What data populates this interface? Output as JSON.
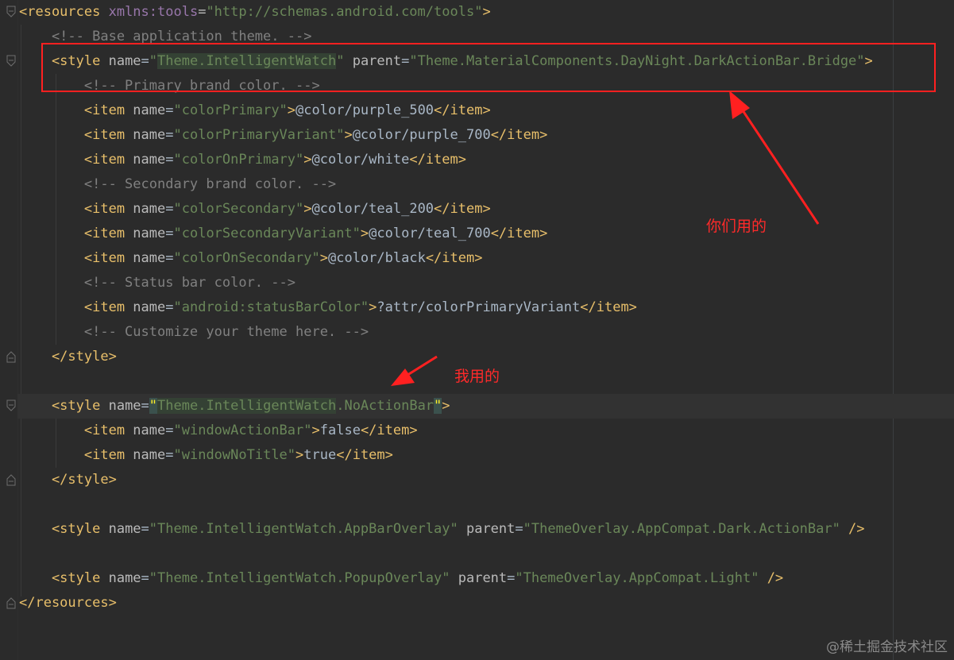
{
  "editor": {
    "lines": [
      {
        "parts": [
          [
            "tag",
            "<resources "
          ],
          [
            "ns",
            "xmlns:tools"
          ],
          [
            "attr",
            "="
          ],
          [
            "val",
            "\"http://schemas.android.com/tools\""
          ],
          [
            "tag",
            ">"
          ]
        ]
      },
      {
        "parts": [
          [
            "com",
            "    <!-- Base application theme. -->"
          ]
        ]
      },
      {
        "parts": [
          [
            "tag",
            "    <style "
          ],
          [
            "attr",
            "name"
          ],
          [
            "txt",
            "="
          ],
          [
            "val",
            "\""
          ],
          [
            "valhl",
            "Theme.IntelligentWatch"
          ],
          [
            "val",
            "\""
          ],
          [
            "attr",
            " parent"
          ],
          [
            "txt",
            "="
          ],
          [
            "val",
            "\"Theme.MaterialComponents.DayNight.DarkActionBar.Bridge\""
          ],
          [
            "tag",
            ">"
          ]
        ]
      },
      {
        "parts": [
          [
            "com",
            "        <!-- Primary brand color. -->"
          ]
        ]
      },
      {
        "parts": [
          [
            "tag",
            "        <item "
          ],
          [
            "attr",
            "name"
          ],
          [
            "txt",
            "="
          ],
          [
            "val",
            "\"colorPrimary\""
          ],
          [
            "tag",
            ">"
          ],
          [
            "txt",
            "@color/purple_500"
          ],
          [
            "tag",
            "</item>"
          ]
        ]
      },
      {
        "parts": [
          [
            "tag",
            "        <item "
          ],
          [
            "attr",
            "name"
          ],
          [
            "txt",
            "="
          ],
          [
            "val",
            "\"colorPrimaryVariant\""
          ],
          [
            "tag",
            ">"
          ],
          [
            "txt",
            "@color/purple_700"
          ],
          [
            "tag",
            "</item>"
          ]
        ]
      },
      {
        "parts": [
          [
            "tag",
            "        <item "
          ],
          [
            "attr",
            "name"
          ],
          [
            "txt",
            "="
          ],
          [
            "val",
            "\"colorOnPrimary\""
          ],
          [
            "tag",
            ">"
          ],
          [
            "txt",
            "@color/white"
          ],
          [
            "tag",
            "</item>"
          ]
        ]
      },
      {
        "parts": [
          [
            "com",
            "        <!-- Secondary brand color. -->"
          ]
        ]
      },
      {
        "parts": [
          [
            "tag",
            "        <item "
          ],
          [
            "attr",
            "name"
          ],
          [
            "txt",
            "="
          ],
          [
            "val",
            "\"colorSecondary\""
          ],
          [
            "tag",
            ">"
          ],
          [
            "txt",
            "@color/teal_200"
          ],
          [
            "tag",
            "</item>"
          ]
        ]
      },
      {
        "parts": [
          [
            "tag",
            "        <item "
          ],
          [
            "attr",
            "name"
          ],
          [
            "txt",
            "="
          ],
          [
            "val",
            "\"colorSecondaryVariant\""
          ],
          [
            "tag",
            ">"
          ],
          [
            "txt",
            "@color/teal_700"
          ],
          [
            "tag",
            "</item>"
          ]
        ]
      },
      {
        "parts": [
          [
            "tag",
            "        <item "
          ],
          [
            "attr",
            "name"
          ],
          [
            "txt",
            "="
          ],
          [
            "val",
            "\"colorOnSecondary\""
          ],
          [
            "tag",
            ">"
          ],
          [
            "txt",
            "@color/black"
          ],
          [
            "tag",
            "</item>"
          ]
        ]
      },
      {
        "parts": [
          [
            "com",
            "        <!-- Status bar color. -->"
          ]
        ]
      },
      {
        "parts": [
          [
            "tag",
            "        <item "
          ],
          [
            "attr",
            "name"
          ],
          [
            "txt",
            "="
          ],
          [
            "val",
            "\"android:statusBarColor\""
          ],
          [
            "tag",
            ">"
          ],
          [
            "txt",
            "?attr/colorPrimaryVariant"
          ],
          [
            "tag",
            "</item>"
          ]
        ]
      },
      {
        "parts": [
          [
            "com",
            "        <!-- Customize your theme here. -->"
          ]
        ]
      },
      {
        "parts": [
          [
            "tag",
            "    </style>"
          ]
        ]
      },
      {
        "parts": []
      },
      {
        "parts": [
          [
            "tag",
            "    <style "
          ],
          [
            "attr",
            "name"
          ],
          [
            "txt",
            "="
          ],
          [
            "bhl",
            "\""
          ],
          [
            "valhl",
            "Theme.IntelligentWatch"
          ],
          [
            "val",
            ".NoActionBar"
          ],
          [
            "bhl",
            "\""
          ],
          [
            "tag",
            ">"
          ]
        ],
        "current": true
      },
      {
        "parts": [
          [
            "tag",
            "        <item "
          ],
          [
            "attr",
            "name"
          ],
          [
            "txt",
            "="
          ],
          [
            "val",
            "\"windowActionBar\""
          ],
          [
            "tag",
            ">"
          ],
          [
            "txt",
            "false"
          ],
          [
            "tag",
            "</item>"
          ]
        ]
      },
      {
        "parts": [
          [
            "tag",
            "        <item "
          ],
          [
            "attr",
            "name"
          ],
          [
            "txt",
            "="
          ],
          [
            "val",
            "\"windowNoTitle\""
          ],
          [
            "tag",
            ">"
          ],
          [
            "txt",
            "true"
          ],
          [
            "tag",
            "</item>"
          ]
        ]
      },
      {
        "parts": [
          [
            "tag",
            "    </style>"
          ]
        ]
      },
      {
        "parts": []
      },
      {
        "parts": [
          [
            "tag",
            "    <style "
          ],
          [
            "attr",
            "name"
          ],
          [
            "txt",
            "="
          ],
          [
            "val",
            "\"Theme.IntelligentWatch.AppBarOverlay\""
          ],
          [
            "attr",
            " parent"
          ],
          [
            "txt",
            "="
          ],
          [
            "val",
            "\"ThemeOverlay.AppCompat.Dark.ActionBar\""
          ],
          [
            "tag",
            " />"
          ]
        ]
      },
      {
        "parts": []
      },
      {
        "parts": [
          [
            "tag",
            "    <style "
          ],
          [
            "attr",
            "name"
          ],
          [
            "txt",
            "="
          ],
          [
            "val",
            "\"Theme.IntelligentWatch.PopupOverlay\""
          ],
          [
            "attr",
            " parent"
          ],
          [
            "txt",
            "="
          ],
          [
            "val",
            "\"ThemeOverlay.AppCompat.Light\""
          ],
          [
            "tag",
            " />"
          ]
        ]
      },
      {
        "parts": [
          [
            "tag",
            "</resources>"
          ]
        ]
      }
    ]
  },
  "annotations": {
    "yours": "你们用的",
    "mine": "我用的",
    "color": "#ff2020"
  },
  "watermark": "@稀土掘金技术社区",
  "icons": [
    "fold-open-icon",
    "fold-close-icon",
    "red-arrow-icon"
  ]
}
